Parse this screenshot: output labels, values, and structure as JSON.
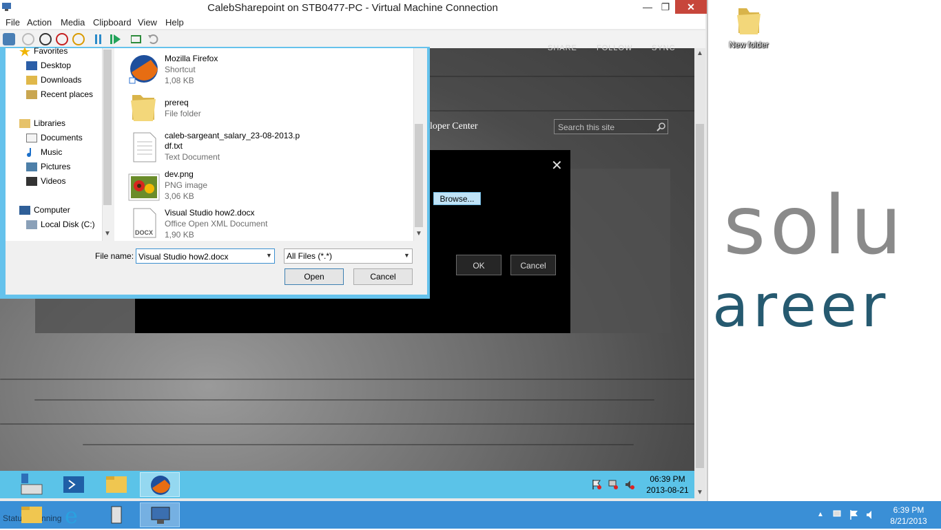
{
  "vm_window": {
    "title": "CalebSharepoint on STB0477-PC - Virtual Machine Connection",
    "min_glyph": "—",
    "max_glyph": "❐",
    "close_glyph": "✕",
    "menu": [
      "File",
      "Action",
      "Media",
      "Clipboard",
      "View",
      "Help"
    ]
  },
  "sharepoint": {
    "top_links": [
      "SHARE",
      "FOLLOW",
      "SYNC"
    ],
    "site_title": "loper Center",
    "search_placeholder": "Search this site",
    "dialog_close": "✕",
    "browse_label": "Browse...",
    "ok_label": "OK",
    "cancel_label": "Cancel"
  },
  "open_dialog": {
    "nav": {
      "favorites": "Favorites",
      "favorites_items": [
        "Desktop",
        "Downloads",
        "Recent places"
      ],
      "libraries": "Libraries",
      "libraries_items": [
        "Documents",
        "Music",
        "Pictures",
        "Videos"
      ],
      "computer": "Computer",
      "computer_items": [
        "Local Disk (C:)"
      ]
    },
    "files": [
      {
        "name": "Mozilla Firefox",
        "type": "Shortcut",
        "size": "1,08 KB",
        "icon": "firefox-icon"
      },
      {
        "name": "prereq",
        "type": "File folder",
        "size": "",
        "icon": "folder-icon"
      },
      {
        "name": "caleb-sargeant_salary_23-08-2013.p",
        "name2": "df.txt",
        "type": "Text Document",
        "size": "",
        "icon": "text-document-icon"
      },
      {
        "name": "dev.png",
        "type": "PNG image",
        "size": "3,06 KB",
        "icon": "flower-image-icon"
      },
      {
        "name": "Visual Studio how2.docx",
        "type": "Office Open XML Document",
        "size": "1,90 KB",
        "icon": "docx-icon"
      }
    ],
    "docx_badge": "DOCX",
    "file_name_label": "File name:",
    "file_name_value": "Visual Studio how2.docx",
    "file_type_value": "All Files (*.*)",
    "open_label": "Open",
    "cancel_label": "Cancel"
  },
  "guest_taskbar": {
    "time": "06:39 PM",
    "date": "2013-08-21"
  },
  "host_desktop": {
    "folder_label": "New folder",
    "bg_text_1": "solu",
    "bg_text_2": "areer"
  },
  "host_taskbar": {
    "time": "6:39 PM",
    "date": "8/21/2013",
    "status_text": "Status: Running"
  },
  "colors": {
    "guest_taskbar": "#5bc3e8",
    "host_taskbar": "#3a8fd6",
    "dialog_frame": "#65c2ec",
    "career_text": "#265a70"
  }
}
